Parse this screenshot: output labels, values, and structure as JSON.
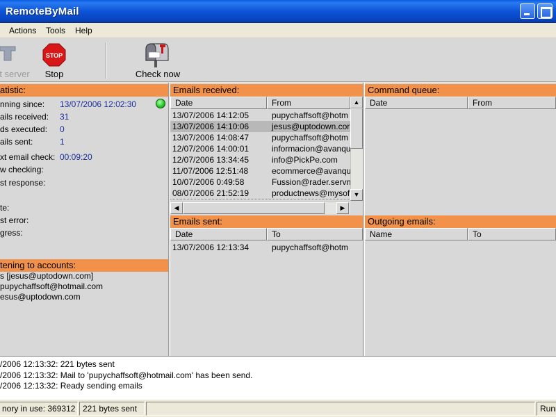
{
  "window": {
    "title": "RemoteByMail"
  },
  "menu": [
    "Actions",
    "Tools",
    "Help"
  ],
  "toolbar": {
    "start_server_label": "t server",
    "stop_label": "Stop",
    "stop_sign_text": "STOP",
    "check_now_label": "Check now"
  },
  "statistic": {
    "header": "atistic:",
    "fields": [
      {
        "label": "nning since:",
        "value": "13/07/2006 12:02:30"
      },
      {
        "label": "ails received:",
        "value": "31"
      },
      {
        "label": "ds executed:",
        "value": "0"
      },
      {
        "label": "ails sent:",
        "value": "1"
      },
      {
        "label": "xt email check:",
        "value": "00:09:20"
      },
      {
        "label": "w checking:",
        "value": ""
      },
      {
        "label": "st response:",
        "value": ""
      },
      {
        "label": "te:",
        "value": ""
      },
      {
        "label": "st error:",
        "value": ""
      },
      {
        "label": "gress:",
        "value": ""
      }
    ],
    "status_color": "#2ecc2e"
  },
  "accounts": {
    "header": "tening to accounts:",
    "items": [
      "s [jesus@uptodown.com]",
      "pupychaffsoft@hotmail.com",
      "esus@uptodown.com"
    ]
  },
  "emails_received": {
    "header": "Emails received:",
    "columns": [
      "Date",
      "From"
    ],
    "rows": [
      {
        "date": "13/07/2006 14:12:05",
        "from": "pupychaffsoft@hotm",
        "selected": false
      },
      {
        "date": "13/07/2006 14:10:06",
        "from": "jesus@uptodown.cor",
        "selected": true
      },
      {
        "date": "13/07/2006 14:08:47",
        "from": "pupychaffsoft@hotm",
        "selected": false
      },
      {
        "date": "12/07/2006 14:00:01",
        "from": "informacion@avanqu",
        "selected": false
      },
      {
        "date": "12/07/2006 13:34:45",
        "from": "info@PickPe.com",
        "selected": false
      },
      {
        "date": "11/07/2006 12:51:48",
        "from": "ecommerce@avanqu",
        "selected": false
      },
      {
        "date": "10/07/2006 0:49:58",
        "from": "Fussion@rader.servn",
        "selected": false
      },
      {
        "date": "08/07/2006 21:52:19",
        "from": "productnews@mysof",
        "selected": false
      }
    ]
  },
  "emails_sent": {
    "header": "Emails sent:",
    "columns": [
      "Date",
      "To"
    ],
    "rows": [
      {
        "date": "13/07/2006 12:13:34",
        "to": "pupychaffsoft@hotm"
      }
    ]
  },
  "command_queue": {
    "header": "Command queue:",
    "columns": [
      "Date",
      "From"
    ]
  },
  "outgoing_emails": {
    "header": "Outgoing emails:",
    "columns": [
      "Name",
      "To"
    ]
  },
  "log": [
    "/2006 12:13:32: 221 bytes sent",
    "/2006 12:13:32: Mail to 'pupychaffsoft@hotmail.com' has been send.",
    "/2006 12:13:32: Ready sending emails"
  ],
  "status": {
    "memory": "nory in use: 369312",
    "bytes": "221 bytes sent",
    "state": "Runn"
  },
  "colors": {
    "header_orange": "#f2924a",
    "value_blue": "#1a2f9a",
    "titlebar_blue": "#0d54d8"
  }
}
